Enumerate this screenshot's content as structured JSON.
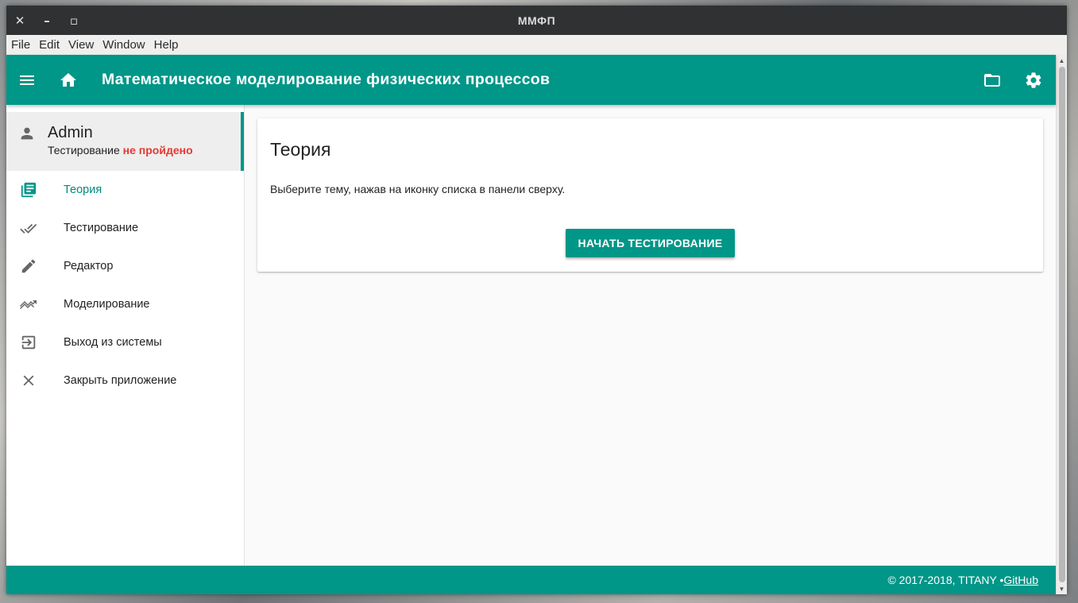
{
  "window": {
    "title": "ММФП",
    "close_glyph": "✕",
    "minimize_glyph": "–",
    "maximize_glyph": "▫"
  },
  "menubar": {
    "items": [
      "File",
      "Edit",
      "View",
      "Window",
      "Help"
    ]
  },
  "toolbar": {
    "title": "Математическое моделирование физических процессов",
    "icons": [
      "menu-icon",
      "home-icon",
      "folder-icon",
      "settings-icon"
    ]
  },
  "user": {
    "name": "Admin",
    "status_prefix": "Тестирование ",
    "status_value": "не пройдено"
  },
  "sidebar": {
    "items": [
      {
        "label": "Теория",
        "icon": "library-books-icon",
        "active": true
      },
      {
        "label": "Тестирование",
        "icon": "done-all-icon",
        "active": false
      },
      {
        "label": "Редактор",
        "icon": "pencil-icon",
        "active": false
      },
      {
        "label": "Моделирование",
        "icon": "trending-icon",
        "active": false
      },
      {
        "label": "Выход из системы",
        "icon": "exit-icon",
        "active": false
      },
      {
        "label": "Закрыть приложение",
        "icon": "close-icon",
        "active": false
      }
    ]
  },
  "card": {
    "title": "Теория",
    "text": "Выберите тему, нажав на иконку списка в панели сверху.",
    "button_label": "НАЧАТЬ ТЕСТИРОВАНИЕ"
  },
  "footer": {
    "copyright": "© 2017-2018, TITANY • ",
    "link_label": "GitHub"
  },
  "colors": {
    "primary": "#009688",
    "error": "#e53935",
    "titlebar": "#2f3133"
  }
}
